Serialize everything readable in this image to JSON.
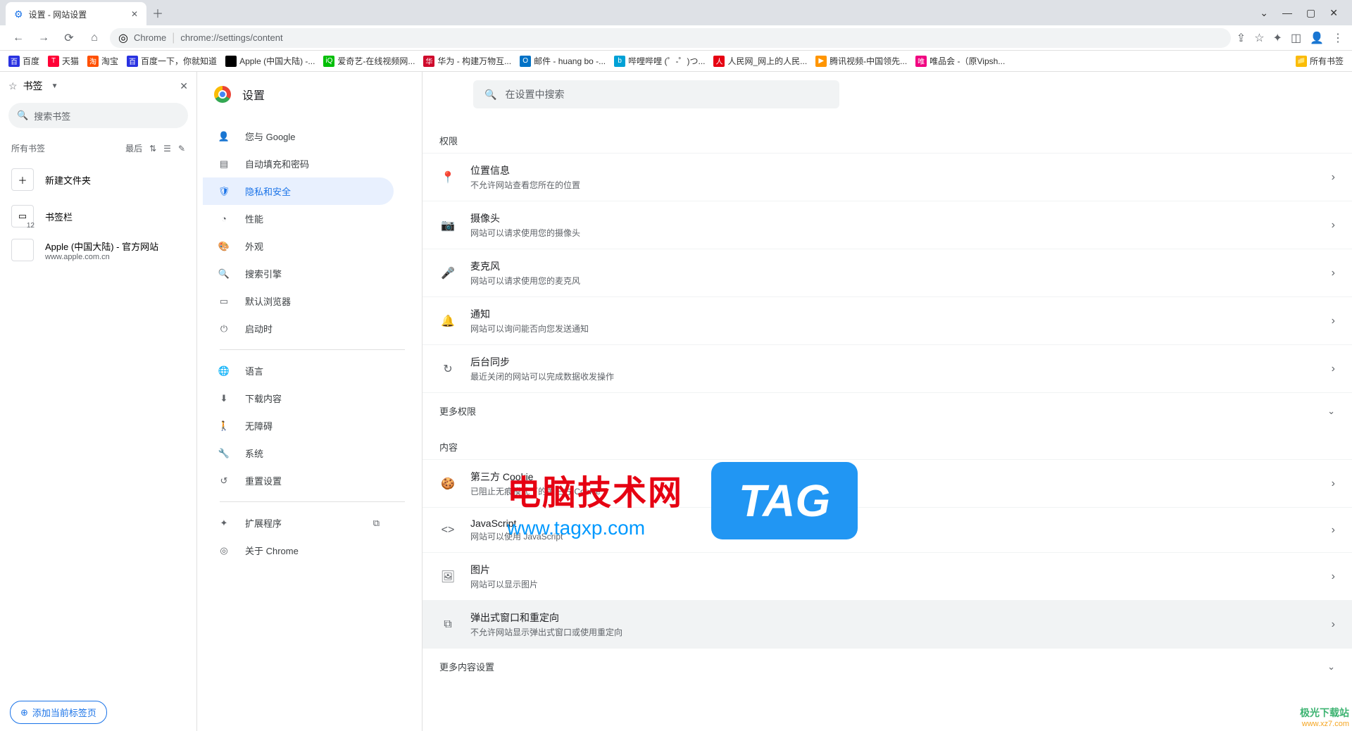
{
  "window": {
    "tab_title": "设置 - 网站设置"
  },
  "urlbar": {
    "chrome_label": "Chrome",
    "url": "chrome://settings/content"
  },
  "bookmarks_bar": {
    "items": [
      {
        "label": "百度",
        "color": "#2932e1"
      },
      {
        "label": "天猫",
        "color": "#ff0036"
      },
      {
        "label": "淘宝",
        "color": "#ff5000"
      },
      {
        "label": "百度一下，你就知道",
        "color": "#2932e1"
      },
      {
        "label": "Apple (中国大陆) -...",
        "color": "#000"
      },
      {
        "label": "爱奇艺-在线视频网...",
        "color": "#00be06"
      },
      {
        "label": "华为 - 构建万物互...",
        "color": "#cf0a2c"
      },
      {
        "label": "邮件 - huang bo -...",
        "color": "#0072c6"
      },
      {
        "label": "哔哩哔哩 (゜-゜)つ...",
        "color": "#00a1d6"
      },
      {
        "label": "人民网_网上的人民...",
        "color": "#e60012"
      },
      {
        "label": "腾讯视频-中国领先...",
        "color": "#ff9500"
      },
      {
        "label": "唯品会 -（原Vipsh...",
        "color": "#f10180"
      }
    ],
    "all_label": "所有书签"
  },
  "bm_panel": {
    "title": "书签",
    "search_placeholder": "搜索书签",
    "all_bookmarks": "所有书签",
    "sort_label": "最后",
    "new_folder": "新建文件夹",
    "entries": {
      "bookmarks_bar": {
        "label": "书签栏",
        "count": "12"
      },
      "apple": {
        "label": "Apple (中国大陆) - 官方网站",
        "sub": "www.apple.com.cn"
      }
    },
    "add_tab": "添加当前标签页"
  },
  "settings": {
    "title": "设置",
    "search_placeholder": "在设置中搜索",
    "nav": {
      "you_google": "您与 Google",
      "autofill": "自动填充和密码",
      "privacy": "隐私和安全",
      "performance": "性能",
      "appearance": "外观",
      "search_engine": "搜索引擎",
      "default_browser": "默认浏览器",
      "on_startup": "启动时",
      "languages": "语言",
      "downloads": "下载内容",
      "accessibility": "无障碍",
      "system": "系统",
      "reset": "重置设置",
      "extensions": "扩展程序",
      "about": "关于 Chrome"
    },
    "permissions_label": "权限",
    "perm": {
      "location": {
        "title": "位置信息",
        "sub": "不允许网站查看您所在的位置"
      },
      "camera": {
        "title": "摄像头",
        "sub": "网站可以请求使用您的摄像头"
      },
      "microphone": {
        "title": "麦克风",
        "sub": "网站可以请求使用您的麦克风"
      },
      "notifications": {
        "title": "通知",
        "sub": "网站可以询问能否向您发送通知"
      },
      "background_sync": {
        "title": "后台同步",
        "sub": "最近关闭的网站可以完成数据收发操作"
      }
    },
    "more_permissions": "更多权限",
    "content_label": "内容",
    "content": {
      "cookies": {
        "title": "第三方 Cookie",
        "sub": "已阻止无痕模式下的第三方 Cookie"
      },
      "javascript": {
        "title": "JavaScript",
        "sub": "网站可以使用 JavaScript"
      },
      "images": {
        "title": "图片",
        "sub": "网站可以显示图片"
      },
      "popups": {
        "title": "弹出式窗口和重定向",
        "sub": "不允许网站显示弹出式窗口或使用重定向"
      }
    },
    "more_content": "更多内容设置"
  },
  "watermarks": {
    "site_cn": "电脑技术网",
    "site_url": "www.tagxp.com",
    "tag": "TAG",
    "dl_site": "极光下载站",
    "dl_url": "www.xz7.com"
  }
}
